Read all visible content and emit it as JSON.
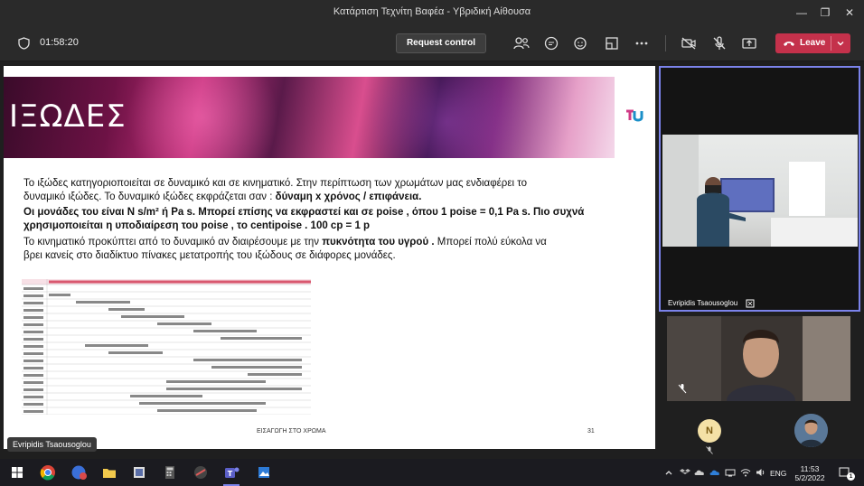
{
  "window": {
    "title": "Κατάρτιση Τεχνίτη Βαφέα - Υβριδική Αίθουσα",
    "minimize": "—",
    "maximize": "❐",
    "close": "✕"
  },
  "toolbar": {
    "timer": "01:58:20",
    "request_control": "Request control",
    "leave": "Leave",
    "icons": [
      "people-icon",
      "chat-icon",
      "reactions-icon",
      "rooms-icon",
      "more-icon",
      "camera-off-icon",
      "mic-off-icon",
      "share-icon"
    ]
  },
  "slide": {
    "title": "ΙΞΩΔΕΣ",
    "p1_a": "Το ιξώδες κατηγοριοποιείται σε δυναμικό και σε κινηματικό. Στην περίπτωση των χρωμάτων μας ενδιαφέρει το",
    "p1_b": "δυναμικό ιξώδες.   Το δυναμικό ιξώδες εκφράζεται σαν : ",
    "p1_bold": "δύναμη x χρόνος / επιφάνεια.",
    "p2_a": "Οι μονάδες του είναι N s/m² ή Pa s. Μπορεί επίσης να εκφραστεί και σε poise , όπου 1 poise = 0,1 Pa s. Πιο συχνά",
    "p2_b": "χρησιμοποιείται η υποδιαίρεση του poise , το centipoise . 100 cp = 1 p",
    "p3_a": "Το κινηματικό προκύπτει από το δυναμικό αν  διαιρέσουμε με την ",
    "p3_bold": "πυκνότητα του υγρού .",
    "p3_c": " Μπορεί πολύ εύκολα να",
    "p3_d": "βρει κανείς στο διαδίκτυο πίνακες μετατροπής του ιξώδους σε διάφορες μονάδες.",
    "footer": "ΕΙΣΑΓΩΓΗ ΣΤΟ ΧΡΩΜΑ",
    "page": "31"
  },
  "presenter": "Evripidis Tsaousoglou",
  "participants": {
    "video1_name": "Evripidis Tsaousoglou",
    "avatar_initial": "N"
  },
  "taskbar": {
    "lang": "ENG",
    "time": "11:53",
    "date": "5/2/2022",
    "notif": "1"
  }
}
